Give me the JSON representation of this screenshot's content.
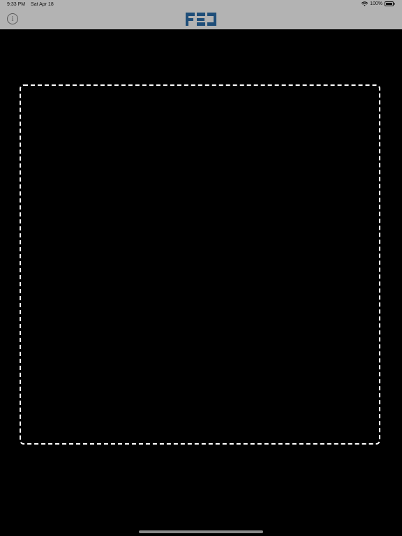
{
  "status_bar": {
    "time": "9:33 PM",
    "date": "Sat Apr 18",
    "battery": "100%",
    "wifi_icon": "wifi-icon",
    "battery_icon": "battery-full-icon"
  },
  "nav_bar": {
    "info_icon": "info-icon",
    "info_label": "i",
    "logo_text": "FEJ",
    "logo_color": "#1f4e79",
    "background_color": "#b3b3b3"
  },
  "main": {
    "background_color": "#000000",
    "frame_border_color": "#ffffff",
    "frame_style": "dashed"
  }
}
